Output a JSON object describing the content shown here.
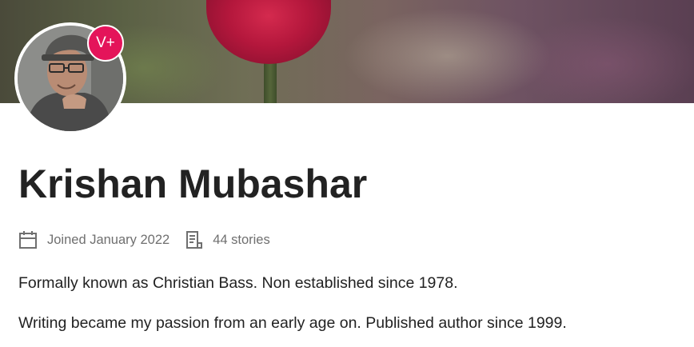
{
  "profile": {
    "name": "Krishan Mubashar",
    "badge": "V+",
    "joined": "Joined January 2022",
    "stories": "44 stories",
    "bio": [
      "Formally known as Christian Bass. Non established since 1978.",
      "Writing became my passion from an early age on. Published author since 1999."
    ]
  },
  "icons": {
    "joined": "calendar-icon",
    "stories": "document-icon"
  },
  "colors": {
    "badge": "#e4145a",
    "text": "#222222",
    "meta_text": "#6f6f6f"
  }
}
